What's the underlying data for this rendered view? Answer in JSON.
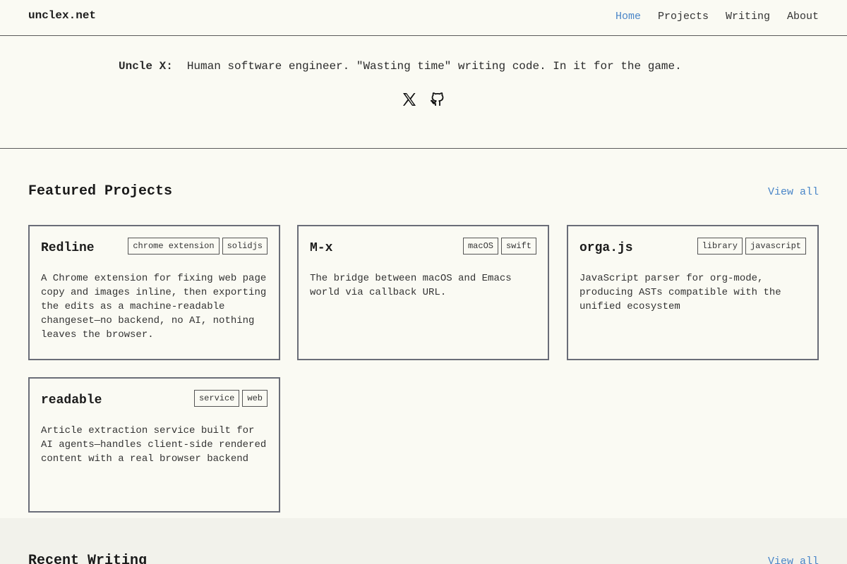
{
  "site": {
    "logo": "unclex.net"
  },
  "nav": {
    "items": [
      {
        "label": "Home",
        "active": true
      },
      {
        "label": "Projects",
        "active": false
      },
      {
        "label": "Writing",
        "active": false
      },
      {
        "label": "About",
        "active": false
      }
    ]
  },
  "hero": {
    "name": "Uncle X:",
    "bio": "Human software engineer. \"Wasting time\" writing code. In it for the game.",
    "socials": [
      {
        "icon": "x-twitter-icon"
      },
      {
        "icon": "github-icon"
      }
    ]
  },
  "featured": {
    "title": "Featured Projects",
    "view_all": "View all",
    "projects": [
      {
        "title": "Redline",
        "tags": [
          "chrome extension",
          "solidjs"
        ],
        "description": "A Chrome extension for fixing web page copy and images inline, then exporting the edits as a machine-readable changeset—no backend, no AI, nothing leaves the browser."
      },
      {
        "title": "M-x",
        "tags": [
          "macOS",
          "swift"
        ],
        "description": "The bridge between macOS and Emacs world via callback URL."
      },
      {
        "title": "orga.js",
        "tags": [
          "library",
          "javascript"
        ],
        "description": "JavaScript parser for org-mode, producing ASTs compatible with the unified ecosystem"
      },
      {
        "title": "readable",
        "tags": [
          "service",
          "web"
        ],
        "description": "Article extraction service built for AI agents—handles client-side rendered content with a real browser backend"
      }
    ]
  },
  "writing": {
    "title": "Recent Writing",
    "view_all": "View all"
  },
  "colors": {
    "background": "#fafaf3",
    "accent": "#4a86c8",
    "border": "#6a6d78"
  }
}
